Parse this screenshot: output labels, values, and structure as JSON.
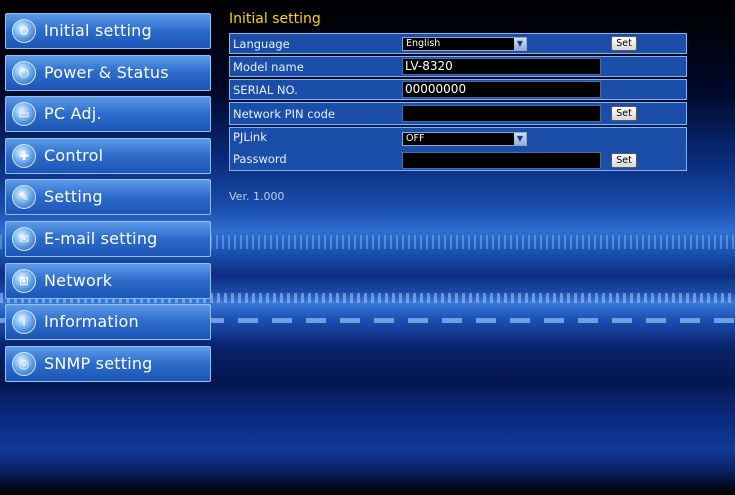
{
  "sidebar": {
    "items": [
      {
        "label": "Initial setting",
        "icon": "wrench-gear-icon"
      },
      {
        "label": "Power & Status",
        "icon": "power-plug-icon"
      },
      {
        "label": "PC Adj.",
        "icon": "monitor-icon"
      },
      {
        "label": "Control",
        "icon": "control-dpad-icon"
      },
      {
        "label": "Setting",
        "icon": "pencil-icon"
      },
      {
        "label": "E-mail setting",
        "icon": "envelope-icon"
      },
      {
        "label": "Network",
        "icon": "network-icon"
      },
      {
        "label": "Information",
        "icon": "info-icon"
      },
      {
        "label": "SNMP setting",
        "icon": "snmp-globe-icon"
      }
    ]
  },
  "main": {
    "title": "Initial setting",
    "language": {
      "label": "Language",
      "value": "English",
      "set_label": "Set"
    },
    "model_name": {
      "label": "Model name",
      "value": "LV-8320"
    },
    "serial_no": {
      "label": "SERIAL NO.",
      "value": "00000000"
    },
    "network_pin": {
      "label": "Network PIN code",
      "value": "",
      "set_label": "Set"
    },
    "pjlink": {
      "label": "PJLink",
      "value": "OFF",
      "password_label": "Password",
      "password_value": "",
      "set_label": "Set"
    },
    "version": "Ver. 1.000"
  },
  "colors": {
    "title_yellow": "#ffd400",
    "panel_blue": "#1a4ea8",
    "nav_blue": "#2d6ccc"
  }
}
